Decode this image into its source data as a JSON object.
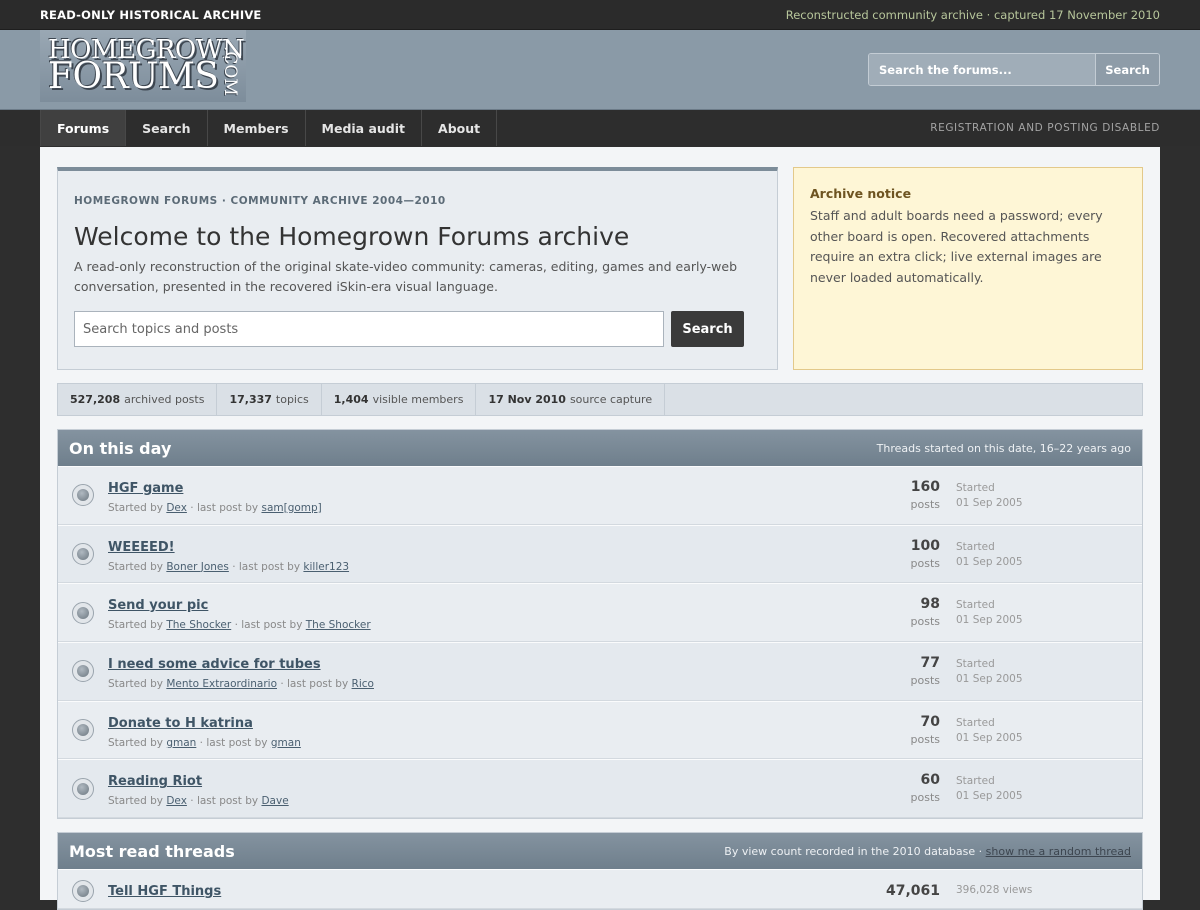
{
  "topbar": {
    "left": "READ-ONLY HISTORICAL ARCHIVE",
    "right": "Reconstructed community archive · captured 17 November 2010"
  },
  "logo": {
    "line1": "HOMEGROWN",
    "line2": "FORUMS",
    "suffix": ".COM"
  },
  "header_search": {
    "placeholder": "Search the forums...",
    "button": "Search"
  },
  "nav": {
    "tabs": [
      "Forums",
      "Search",
      "Members",
      "Media audit",
      "About"
    ],
    "active": "Forums",
    "notice": "REGISTRATION AND POSTING DISABLED"
  },
  "welcome": {
    "eyebrow": "HOMEGROWN FORUMS · COMMUNITY ARCHIVE 2004—2010",
    "title": "Welcome to the Homegrown Forums archive",
    "description": "A read-only reconstruction of the original skate-video community: cameras, editing, games and early-web conversation, presented in the recovered iSkin-era visual language.",
    "search_placeholder": "Search topics and posts",
    "search_button": "Search"
  },
  "archive_notice": {
    "title": "Archive notice",
    "body": "Staff and adult boards need a password; every other board is open. Recovered attachments require an extra click; live external images are never loaded automatically."
  },
  "stats": [
    {
      "value": "527,208",
      "label": "archived posts"
    },
    {
      "value": "17,337",
      "label": "topics"
    },
    {
      "value": "1,404",
      "label": "visible members"
    },
    {
      "value": "17 Nov 2010",
      "label": "source capture"
    }
  ],
  "on_this_day": {
    "title": "On this day",
    "subtitle": "Threads started on this date, 16–22 years ago",
    "started_label": "Started",
    "posts_label": "posts",
    "threads": [
      {
        "title": "HGF game",
        "starter": "Dex",
        "last": "sam[gomp]",
        "posts": "160",
        "date": "01 Sep 2005"
      },
      {
        "title": "WEEEED!",
        "starter": "Boner Jones",
        "last": "killer123",
        "posts": "100",
        "date": "01 Sep 2005"
      },
      {
        "title": "Send your pic",
        "starter": "The Shocker",
        "last": "The Shocker",
        "posts": "98",
        "date": "01 Sep 2005"
      },
      {
        "title": "I need some advice for tubes",
        "starter": "Mento Extraordinario",
        "last": "Rico",
        "posts": "77",
        "date": "01 Sep 2005"
      },
      {
        "title": "Donate to H katrina",
        "starter": "gman",
        "last": "gman",
        "posts": "70",
        "date": "01 Sep 2005"
      },
      {
        "title": "Reading Riot",
        "starter": "Dex",
        "last": "Dave",
        "posts": "60",
        "date": "01 Sep 2005"
      }
    ]
  },
  "meta_text": {
    "started_by": "Started by",
    "last_post_by": "· last post by"
  },
  "most_read": {
    "title": "Most read threads",
    "subtitle": "By view count recorded in the 2010 database ·",
    "random_link": "show me a random thread",
    "threads": [
      {
        "title": "Tell HGF Things",
        "count": "47,061",
        "views": "396,028 views"
      }
    ]
  }
}
